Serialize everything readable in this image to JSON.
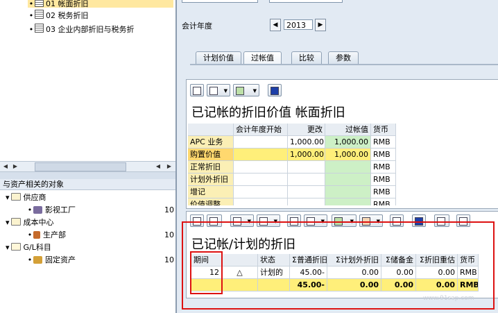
{
  "tree": {
    "items": [
      {
        "num": "01",
        "label": "帐面折旧",
        "selected": true
      },
      {
        "num": "02",
        "label": "税务折旧",
        "selected": false
      },
      {
        "num": "03",
        "label": "企业内部折旧与税务折",
        "selected": false
      }
    ]
  },
  "objects": {
    "header": "与资产相关的对象",
    "groups": [
      {
        "label": "供应商",
        "child": "影视工厂",
        "count": "10"
      },
      {
        "label": "成本中心",
        "child": "生产部",
        "count": "10"
      },
      {
        "label": "G/L科目",
        "child": "固定资产",
        "count": "10"
      }
    ]
  },
  "fiscal_year": {
    "label": "会计年度",
    "value": "2013"
  },
  "tabs": [
    "计划价值",
    "过帐值",
    "比较",
    "参数"
  ],
  "grid1": {
    "title": "已记帐的折旧价值 帐面折旧",
    "columns": [
      "",
      "会计年度开始",
      "更改",
      "过帐值",
      "货币"
    ],
    "rows": [
      {
        "label": "APC 业务",
        "start": "",
        "change": "1,000.00",
        "posted": "1,000.00",
        "curr": "RMB"
      },
      {
        "label": "购置价值",
        "start": "",
        "change": "1,000.00",
        "posted": "1,000.00",
        "curr": "RMB"
      },
      {
        "label": "正常折旧",
        "start": "",
        "change": "",
        "posted": "",
        "curr": "RMB"
      },
      {
        "label": "计划外折旧",
        "start": "",
        "change": "",
        "posted": "",
        "curr": "RMB"
      },
      {
        "label": "增记",
        "start": "",
        "change": "",
        "posted": "",
        "curr": "RMB"
      },
      {
        "label": "价值调整",
        "start": "",
        "change": "",
        "posted": "",
        "curr": "RMB"
      }
    ]
  },
  "grid2": {
    "title": "已记帐/计划的折旧",
    "columns": [
      "期间",
      "",
      "状态",
      "Σ普通折旧",
      "Σ计划外折旧",
      "Σ储备金",
      "Σ折旧重估",
      "货币"
    ],
    "rows": [
      {
        "period": "12",
        "icon": "△",
        "status": "计划的",
        "normal": "45.00-",
        "unplanned": "0.00",
        "reserve": "0.00",
        "reval": "0.00",
        "curr": "RMB"
      }
    ],
    "totals": {
      "normal": "45.00-",
      "unplanned": "0.00",
      "reserve": "0.00",
      "reval": "0.00",
      "curr": "RMB"
    }
  },
  "watermark": "www.91sap.com"
}
